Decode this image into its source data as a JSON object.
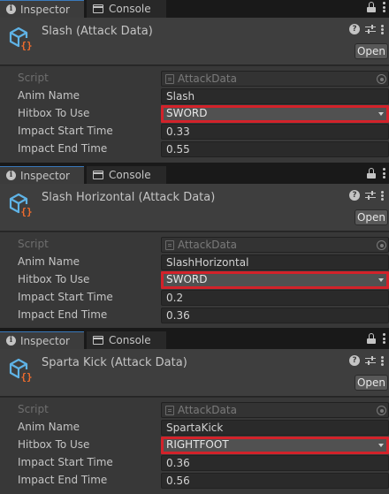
{
  "tabs": {
    "inspector": "Inspector",
    "console": "Console"
  },
  "open_label": "Open",
  "panels": [
    {
      "title": "Slash (Attack Data)",
      "script_label": "Script",
      "script_value": "AttackData",
      "fields": {
        "anim_name": {
          "label": "Anim Name",
          "value": "Slash"
        },
        "hitbox": {
          "label": "Hitbox To Use",
          "value": "SWORD"
        },
        "impact_start": {
          "label": "Impact Start Time",
          "value": "0.33"
        },
        "impact_end": {
          "label": "Impact End Time",
          "value": "0.55"
        }
      }
    },
    {
      "title": "Slash Horizontal (Attack Data)",
      "script_label": "Script",
      "script_value": "AttackData",
      "fields": {
        "anim_name": {
          "label": "Anim Name",
          "value": "SlashHorizontal"
        },
        "hitbox": {
          "label": "Hitbox To Use",
          "value": "SWORD"
        },
        "impact_start": {
          "label": "Impact Start Time",
          "value": "0.2"
        },
        "impact_end": {
          "label": "Impact End Time",
          "value": "0.36"
        }
      }
    },
    {
      "title": "Sparta Kick (Attack Data)",
      "script_label": "Script",
      "script_value": "AttackData",
      "fields": {
        "anim_name": {
          "label": "Anim Name",
          "value": "SpartaKick"
        },
        "hitbox": {
          "label": "Hitbox To Use",
          "value": "RIGHTFOOT"
        },
        "impact_start": {
          "label": "Impact Start Time",
          "value": "0.36"
        },
        "impact_end": {
          "label": "Impact End Time",
          "value": "0.56"
        }
      }
    }
  ],
  "colors": {
    "highlight": "#d3222a",
    "asset_icon_blue": "#5fb3e6",
    "asset_icon_orange": "#f06c2d",
    "tab_accent": "#3a79bb"
  },
  "icons": [
    "info-icon",
    "console-icon",
    "lock-icon",
    "kebab-menu-icon",
    "scriptable-object-icon",
    "help-icon",
    "preset-icon",
    "script-file-icon",
    "object-picker-icon",
    "dropdown-arrow-icon"
  ]
}
